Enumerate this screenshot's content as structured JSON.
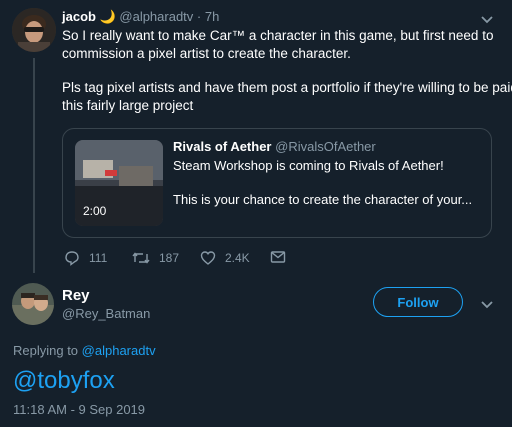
{
  "original_tweet": {
    "display_name": "jacob 🌙",
    "handle": "@alpharadtv",
    "separator": "·",
    "time": "7h",
    "text_line1": "So I really want to make Car™ a character in this game, but first need to",
    "text_line2": "commission a pixel artist to create the character.",
    "text_line3": "Pls tag pixel artists and have them post a portfolio if they're willing to be paid for",
    "text_line4": "this fairly large project",
    "card": {
      "author_name": "Rivals of Aether",
      "author_handle": "@RivalsOfAether",
      "line1": "Steam Workshop is coming to Rivals of Aether!",
      "line2": "This is your chance to create the character of your...",
      "video_duration": "2:00"
    },
    "actions": {
      "replies": "111",
      "retweets": "187",
      "likes": "2.4K"
    }
  },
  "reply_tweet": {
    "display_name": "Rey",
    "handle": "@Rey_Batman",
    "follow_label": "Follow",
    "replying_prefix": "Replying to",
    "replying_handle": "@alpharadtv",
    "text": "@tobyfox",
    "timestamp": "11:18 AM - 9 Sep 2019"
  },
  "colors": {
    "background": "#15202b",
    "accent": "#1da1f2",
    "muted": "#8899a6",
    "border": "#38444d"
  },
  "icons": [
    "reply-icon",
    "retweet-icon",
    "like-icon",
    "dm-icon",
    "chevron-down-icon",
    "play-thumbnail"
  ]
}
